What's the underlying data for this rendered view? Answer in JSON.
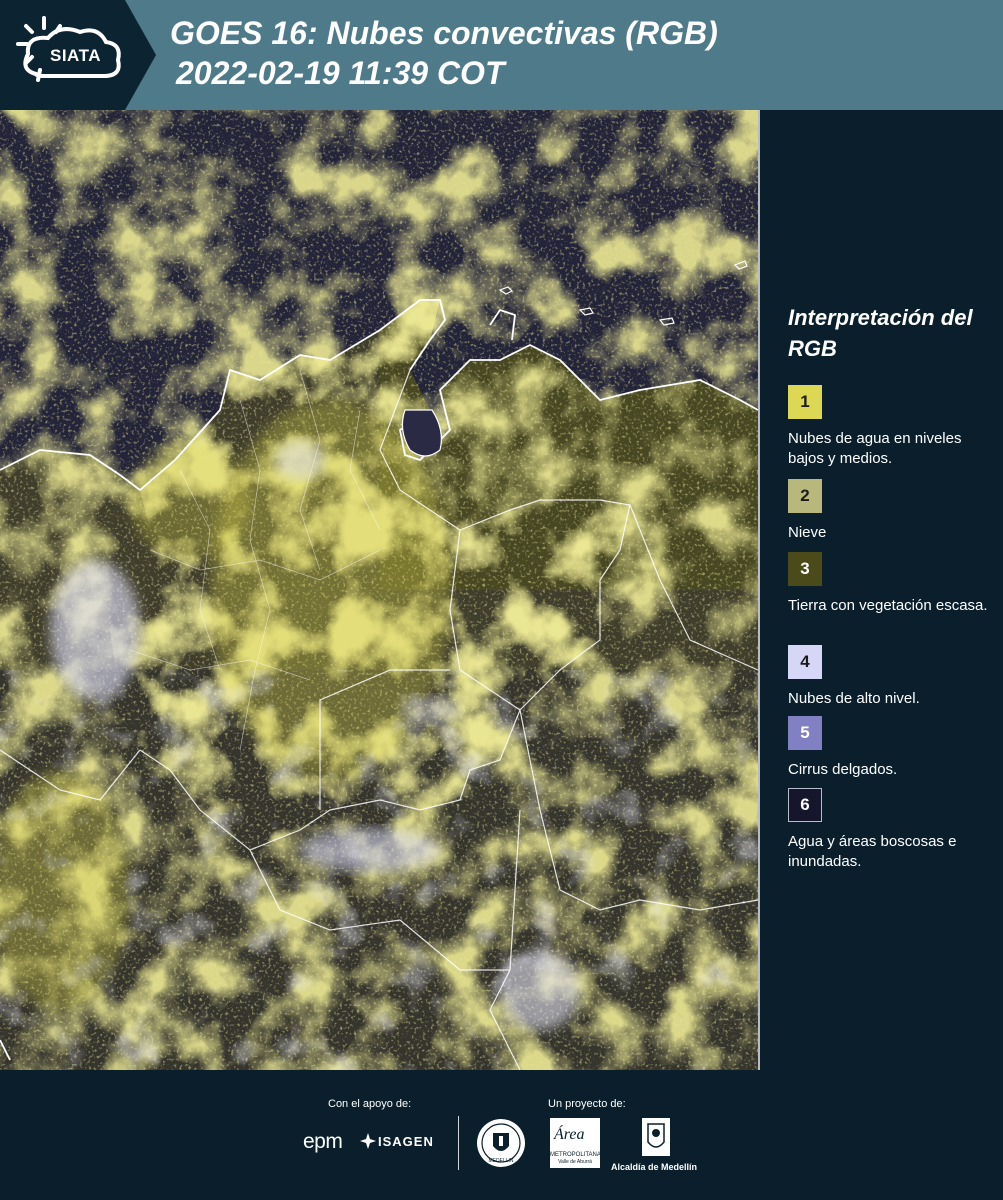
{
  "header": {
    "logo_label": "SIATA",
    "title": "GOES 16: Nubes convectivas (RGB)",
    "subtitle": "2022-02-19 11:39 COT"
  },
  "map": {
    "region_label": "",
    "colors": {
      "background": "#24243a",
      "low_cloud": "#d8d24e",
      "vegetation": "#4e4c2a",
      "high_cloud": "#d6d6f0",
      "borders": "#ffffff"
    }
  },
  "legend": {
    "title": "Interpretación del RGB",
    "items": [
      {
        "number": "1",
        "color": "#dcd854",
        "text_color": "#1b1b1b",
        "label": "Nubes de agua en niveles bajos y medios."
      },
      {
        "number": "2",
        "color": "#b9b87c",
        "text_color": "#1b1b1b",
        "label": "Nieve"
      },
      {
        "number": "3",
        "color": "#4b4a1a",
        "text_color": "#ffffff",
        "label": "Tierra con vegetación escasa."
      },
      {
        "number": "4",
        "color": "#d6d6f6",
        "text_color": "#1b1b1b",
        "label": "Nubes de alto nivel."
      },
      {
        "number": "5",
        "color": "#8080c2",
        "text_color": "#ffffff",
        "label": "Cirrus delgados."
      },
      {
        "number": "6",
        "color": "#15152c",
        "text_color": "#ffffff",
        "label": "Agua y áreas boscosas e inundadas."
      }
    ]
  },
  "footer": {
    "support_caption": "Con el apoyo de:",
    "project_caption": "Un proyecto de:",
    "logos": {
      "epm": "epm",
      "isagen": "ISAGEN",
      "seal": "MEDELLIN",
      "area_script": "Área",
      "area_line1": "METROPOLITANA",
      "area_line2": "Valle de Aburrá",
      "alcaldia": "Alcaldía de Medellín"
    }
  }
}
